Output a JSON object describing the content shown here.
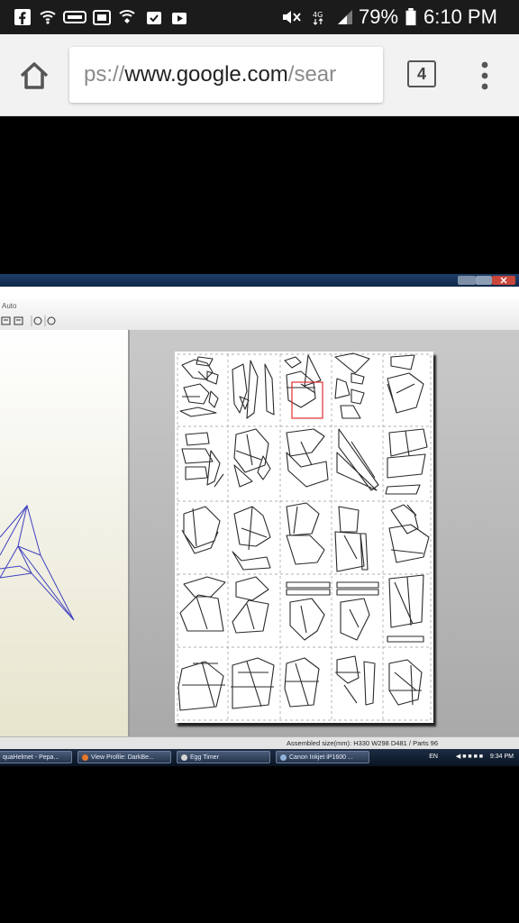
{
  "status_bar": {
    "battery_percent": "79%",
    "time": "6:10 PM",
    "icons": [
      "facebook-icon",
      "wifi-calling-icon",
      "sandisk-icon",
      "flipboard-icon",
      "shield-icon",
      "checkmark-box-icon",
      "play-store-icon",
      "mute-icon",
      "4g-icon",
      "signal-icon",
      "battery-icon"
    ]
  },
  "browser": {
    "url_scheme": "ps://",
    "url_domain": "www.google.com",
    "url_path": "/sear",
    "tab_count": "4"
  },
  "screenshot": {
    "toolbar_label": "Auto",
    "status_text": "Assembled size(mm): H330 W298 D481 / Parts 96",
    "taskbar": [
      {
        "label": "quaHelmet - Pepa...",
        "icon_color": "#cfd8e8"
      },
      {
        "label": "View Profile: DarkBe...",
        "icon_color": "#e8772a"
      },
      {
        "label": "Egg Timer",
        "icon_color": "#d6d6d6"
      },
      {
        "label": "Canon Inkjet iP1600 ...",
        "icon_color": "#8fb3d9"
      }
    ],
    "tray_lang": "EN",
    "tray_time": "9:34 PM",
    "highlight_color": "#e03030",
    "line_color": "#2a2a2a"
  }
}
